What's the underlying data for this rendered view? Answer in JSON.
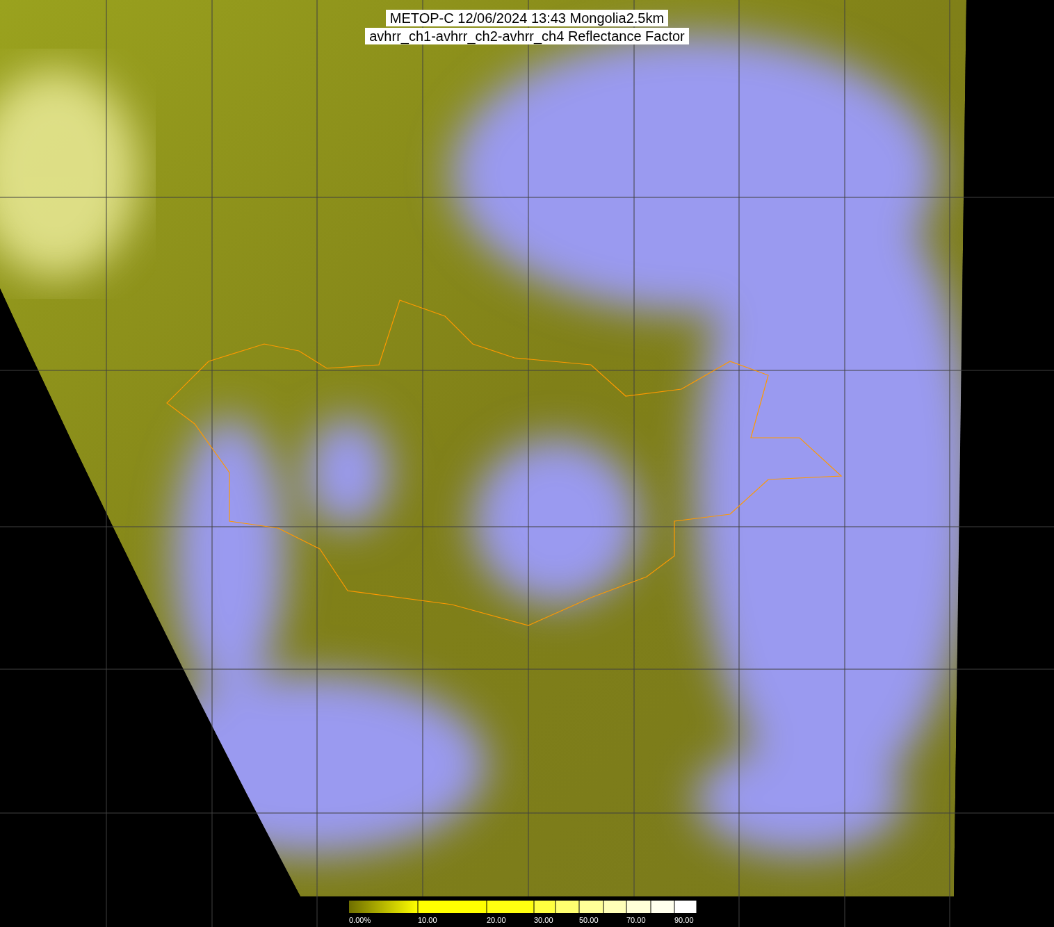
{
  "title": {
    "line_1": "METOP-C 12/06/2024 13:43 Mongolia2.5km",
    "line_2": "avhrr_ch1-avhrr_ch2-avhrr_ch4 Reflectance Factor"
  },
  "colorbar": {
    "labels": [
      "0.00%",
      "10.00",
      "20.00",
      "30.00",
      "50.00",
      "70.00",
      "90.00"
    ]
  }
}
